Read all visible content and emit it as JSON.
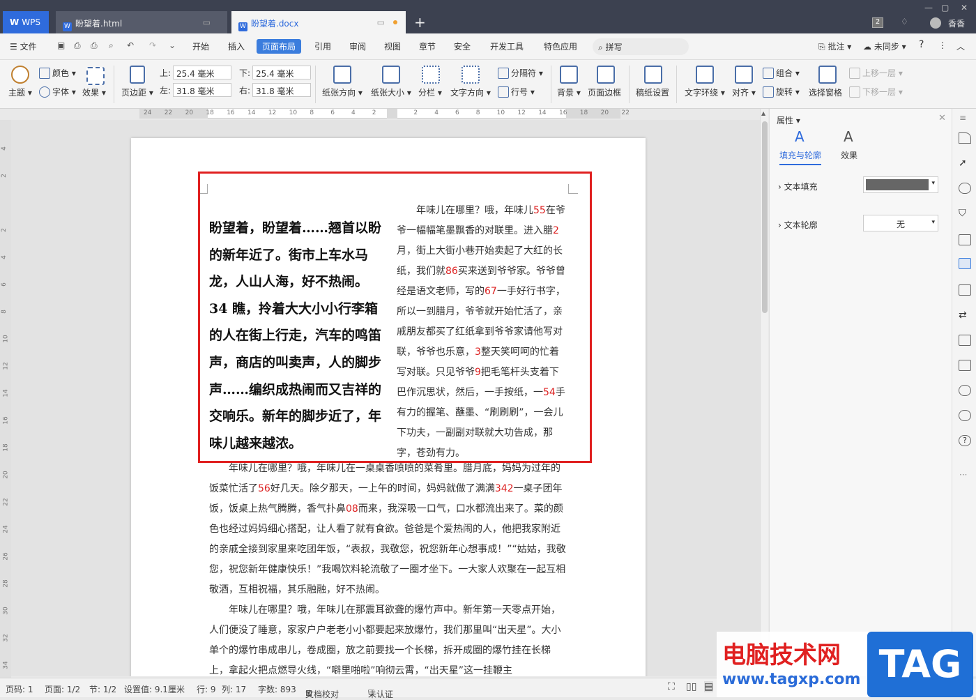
{
  "titlebar": {
    "app_tab": "WPS",
    "doc_tabs": [
      {
        "label": "盼望着.html"
      },
      {
        "label": "盼望着.docx"
      }
    ],
    "new_tab": "+",
    "user": "香香",
    "badge": "2"
  },
  "menubar": {
    "file": "文件",
    "items": [
      "开始",
      "插入",
      "页面布局",
      "引用",
      "审阅",
      "视图",
      "章节",
      "安全",
      "开发工具",
      "特色应用"
    ],
    "search": "拼写",
    "comment": "批注",
    "sync": "未同步",
    "help": "?"
  },
  "ribbon": {
    "theme": "主题",
    "color": "颜色",
    "font": "字体",
    "effect": "效果",
    "margins": "页边距",
    "top_label": "上:",
    "top_value": "25.4 毫米",
    "bottom_label": "下:",
    "bottom_value": "25.4 毫米",
    "left_label": "左:",
    "left_value": "31.8 毫米",
    "right_label": "右:",
    "right_value": "31.8 毫米",
    "orientation": "纸张方向",
    "size": "纸张大小",
    "columns": "分栏",
    "text_direction": "文字方向",
    "break": "分隔符",
    "line_numbers": "行号",
    "background": "背景",
    "page_border": "页面边框",
    "draft": "稿纸设置",
    "wrap": "文字环绕",
    "align": "对齐",
    "group": "组合",
    "rotate": "旋转",
    "select_pane": "选择窗格",
    "bring_forward": "上移一层",
    "send_backward": "下移一层"
  },
  "ruler": {
    "marks": [
      "24",
      "22",
      "20",
      "18",
      "16",
      "14",
      "12",
      "10",
      "8",
      "6",
      "4",
      "2",
      "",
      "2",
      "4",
      "6",
      "8",
      "10",
      "12",
      "14",
      "16",
      "18",
      "20",
      "22"
    ],
    "vmarks": [
      "4",
      "2",
      "",
      "2",
      "4",
      "6",
      "8",
      "10",
      "12",
      "14",
      "16",
      "18",
      "20",
      "22",
      "24",
      "26",
      "28",
      "30",
      "32",
      "34"
    ]
  },
  "document": {
    "bold_text": "盼望着，盼望着……翘首以盼的新年近了。街市上车水马龙，人山人海，好不热闹。34 瞧，拎着大大小小行李箱的人在街上行走，汽车的鸣笛声，商店的叫卖声，人的脚步声……编织成热闹而又吉祥的交响乐。新年的脚步近了，年味儿越来越浓。",
    "col_text": [
      {
        "t": "年味儿在哪里？哦，年味儿"
      },
      {
        "r": "55"
      },
      {
        "t": "在爷爷一幅幅笔墨飘香的对联里。进入腊"
      },
      {
        "r": "2"
      },
      {
        "t": "月，街上大街小巷开始卖起了大红的长纸，我们就"
      },
      {
        "r": "86"
      },
      {
        "t": "买来送到爷爷家。爷爷曾经是语文老师，写的"
      },
      {
        "r": "67"
      },
      {
        "t": "一手好行书字，所以一到腊月，爷爷就开始忙活了，亲戚朋友都买了红纸拿到爷爷家请他写对联，爷爷也乐意，"
      },
      {
        "r": "3"
      },
      {
        "t": "整天笑呵呵的忙着写对联。只见爷爷"
      },
      {
        "r": "9"
      },
      {
        "t": "把毛笔杆头支着下巴作沉思状，然后，一手按纸，一"
      },
      {
        "r": "54"
      },
      {
        "t": "手有力的握笔、蘸墨、“刷刷刷”，一会儿下功夫，一副副对联就大功告成，那字，苍劲有力。"
      }
    ],
    "body_p1": [
      {
        "t": "　　年味儿在哪里？哦，年味儿在一桌桌香喷喷的菜肴里。腊月底，妈妈为过年的饭菜忙活了"
      },
      {
        "r": "56"
      },
      {
        "t": "好几天。除夕那天，一上午的时间，妈妈就做了满满"
      },
      {
        "r": "342"
      },
      {
        "t": "一桌子团年饭，饭桌上热气腾腾，香气扑鼻"
      },
      {
        "r": "08"
      },
      {
        "t": "而来，我深吸一口气，口水都流出来了。菜的颜色也经过妈妈细心搭配，让人看了就有食欲。爸爸是个爱热闹的人，他把我家附近的亲戚全接到家里来吃团年饭，“表叔，我敬您，祝您新年心想事成！”“姑姑，我敬您，祝您新年健康快乐！”我喝饮料轮流敬了一圈才坐下。一大家人欢聚在一起互相敬酒，互相祝福，其乐融融，好不热闹。"
      }
    ],
    "body_p2": "　　年味儿在哪里？哦，年味儿在那震耳欲聋的爆竹声中。新年第一天零点开始，人们便没了睡意，家家户户老老小小都要起来放爆竹，我们那里叫“出天星”。大小单个的爆竹串成串儿，卷成圈，放之前要找一个长梯，拆开成圈的爆竹挂在长梯上，拿起火把点燃导火线，“噼里啪啦”响彻云霄，“出天星”这一挂鞭主"
  },
  "panel": {
    "title": "属性",
    "tab_fill": "填充与轮廓",
    "tab_effect": "效果",
    "text_fill": "文本填充",
    "text_outline": "文本轮廓",
    "outline_value": "无",
    "fill_color": "#666666"
  },
  "statusbar": {
    "page": "页码: 1",
    "pages": "页面: 1/2",
    "section": "节: 1/2",
    "setting": "设置值: 9.1厘米",
    "row": "行: 9",
    "col": "列: 17",
    "words": "字数: 893",
    "proof": "文档校对",
    "auth": "未认证"
  },
  "watermark": {
    "title": "电脑技术网",
    "url": "www.tagxp.com",
    "tag": "TAG"
  },
  "colors": {
    "frame": "#e02020",
    "accent": "#3b7ddd",
    "number_red": "#dd2222"
  }
}
